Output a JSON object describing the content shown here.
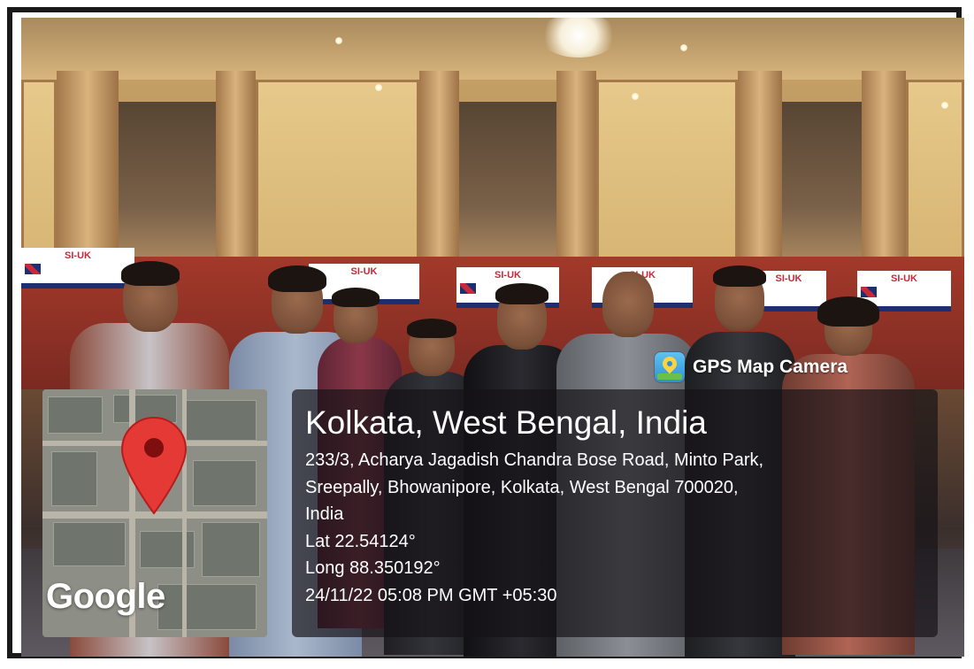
{
  "overlay": {
    "brand_label": "GPS Map Camera",
    "brand_icon": "gps-map-camera-app-icon",
    "location_title": "Kolkata, West Bengal, India",
    "address_line_1": "233/3, Acharya Jagadish Chandra Bose Road, Minto Park,",
    "address_line_2": "Sreepally, Bhowanipore, Kolkata, West Bengal 700020,",
    "address_line_3": "India",
    "latitude": "Lat 22.54124°",
    "longitude": "Long 88.350192°",
    "timestamp": "24/11/22 05:08 PM GMT +05:30"
  },
  "map": {
    "attribution": "Google",
    "pin_color": "#e53935",
    "map_icon": "location-pin-icon"
  },
  "photo": {
    "banner_logo": "SI-UK",
    "colors": {
      "frame": "#1a1a1a",
      "overlay_bg": "#141216",
      "banner_blue": "#1c2f6e",
      "banner_red": "#c8283a"
    }
  }
}
